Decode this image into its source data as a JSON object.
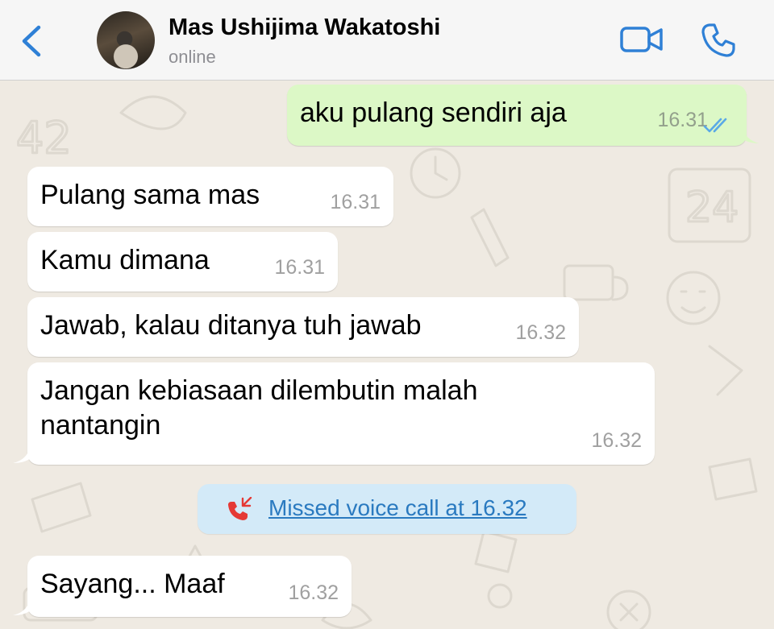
{
  "header": {
    "contact_name": "Mas Ushijima Wakatoshi",
    "status": "online",
    "back_icon": "chevron-left-icon",
    "video_icon": "video-call-icon",
    "call_icon": "phone-icon"
  },
  "colors": {
    "accent": "#2f80d6",
    "outgoing_bubble": "#dcf8c6",
    "incoming_bubble": "#ffffff",
    "system_bubble": "#d3eaf8",
    "chat_background": "#efeae2",
    "missed_call_red": "#e53935",
    "read_ticks": "#5aa9e6"
  },
  "messages": [
    {
      "direction": "outgoing",
      "text": "aku pulang sendiri aja",
      "time": "16.31",
      "status": "read"
    },
    {
      "direction": "incoming",
      "text": "Pulang sama mas",
      "time": "16.31"
    },
    {
      "direction": "incoming",
      "text": "Kamu dimana",
      "time": "16.31"
    },
    {
      "direction": "incoming",
      "text": "Jawab, kalau ditanya tuh jawab",
      "time": "16.32"
    },
    {
      "direction": "incoming",
      "text": "Jangan kebiasaan dilembutin malah nantangin",
      "time": "16.32"
    },
    {
      "direction": "incoming",
      "text": "Sayang... Maaf",
      "time": "16.32"
    }
  ],
  "system_message": {
    "icon": "missed-call-icon",
    "text": "Missed voice call at 16.32"
  }
}
